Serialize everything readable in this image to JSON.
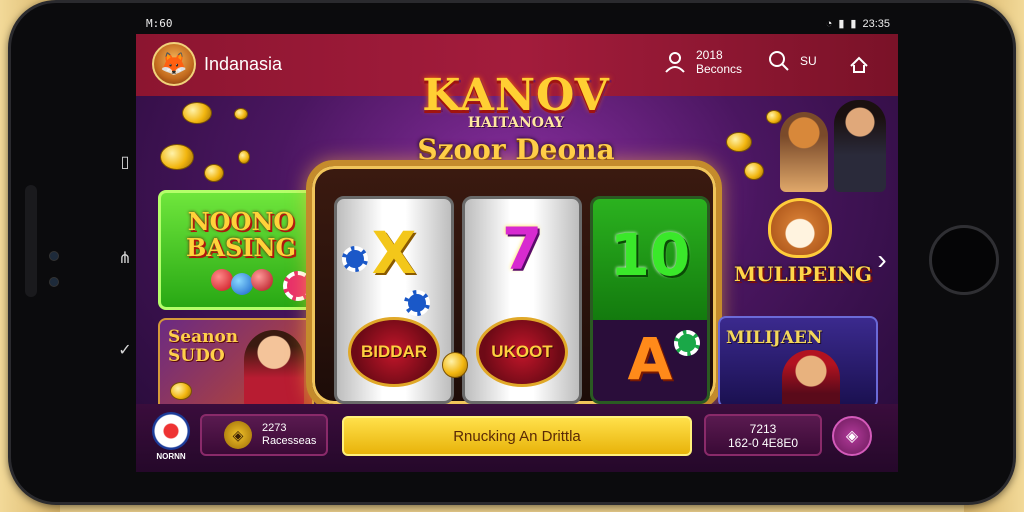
{
  "status_bar": {
    "time": "M:60",
    "right_text": "23:35",
    "wifi_icon": "wifi-icon",
    "signal_icon": "signal-icon",
    "battery_icon": "battery-icon"
  },
  "topbar": {
    "app_name": "Indanasia",
    "stat_value": "2018",
    "stat_label": "Beconcs",
    "search_value": "SU",
    "icons": [
      "user-icon",
      "search-icon",
      "home-icon"
    ]
  },
  "logo": {
    "line1": "KANOV",
    "line2": "HAITANOAY",
    "line3": "Szoor Deona"
  },
  "reels": [
    {
      "top_symbol": "X",
      "bottom_badge": "BIDDAR"
    },
    {
      "top_symbol": "7",
      "bottom_badge": "UKOOT"
    },
    {
      "top_symbol": "10",
      "bottom_symbol": "A"
    }
  ],
  "cards": {
    "green": "NOONO BASING",
    "purple": "Seanon SUDO",
    "dog": "MULIPEING",
    "blue": "MILIJAEN"
  },
  "bottombar": {
    "avatar_label": "NORNN",
    "left_value": "2273",
    "left_label": "Racesseas",
    "cta_label": "Rnucking An Drittla",
    "right_line1": "7213",
    "right_line2": "162-0 4E8E0"
  },
  "colors": {
    "topbar": "#a31c3c",
    "cta": "#ffd42a",
    "screen_bg": "#4a1660"
  }
}
